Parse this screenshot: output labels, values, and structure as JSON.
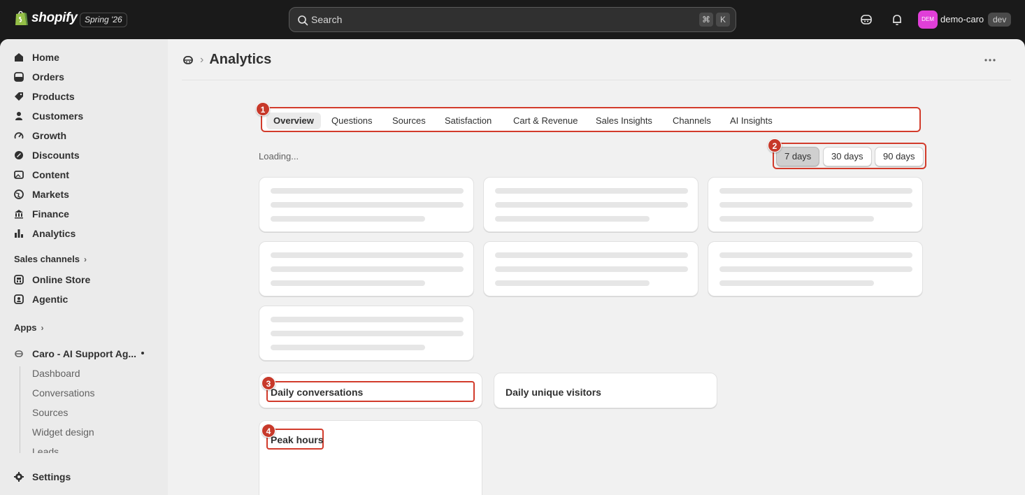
{
  "topbar": {
    "brand": "shopify",
    "version": "Spring '26",
    "search_placeholder": "Search",
    "shortcut_cmd": "⌘",
    "shortcut_key": "K",
    "avatar_initials": "DEM",
    "store_name": "demo-caro",
    "env_badge": "dev"
  },
  "sidebar": {
    "items": [
      {
        "label": "Home",
        "icon": "home-icon"
      },
      {
        "label": "Orders",
        "icon": "inbox-icon"
      },
      {
        "label": "Products",
        "icon": "tag-icon"
      },
      {
        "label": "Customers",
        "icon": "person-icon"
      },
      {
        "label": "Growth",
        "icon": "gauge-icon"
      },
      {
        "label": "Discounts",
        "icon": "discount-icon"
      },
      {
        "label": "Content",
        "icon": "image-icon"
      },
      {
        "label": "Markets",
        "icon": "globe-icon"
      },
      {
        "label": "Finance",
        "icon": "bank-icon"
      },
      {
        "label": "Analytics",
        "icon": "bar-chart-icon"
      }
    ],
    "sales_channels_label": "Sales channels",
    "channels": [
      {
        "label": "Online Store",
        "icon": "store-icon"
      },
      {
        "label": "Agentic",
        "icon": "agent-icon"
      }
    ],
    "apps_label": "Apps",
    "app_name": "Caro - AI Support Ag...",
    "app_subitems": [
      "Dashboard",
      "Conversations",
      "Sources",
      "Widget design",
      "Leads"
    ],
    "settings_label": "Settings"
  },
  "main": {
    "title": "Analytics",
    "tabs": [
      "Overview",
      "Questions",
      "Sources",
      "Satisfaction",
      "Cart & Revenue",
      "Sales Insights",
      "Channels",
      "AI Insights"
    ],
    "active_tab": "Overview",
    "loading_text": "Loading...",
    "ranges": [
      "7 days",
      "30 days",
      "90 days"
    ],
    "selected_range": "7 days",
    "cards": {
      "daily_conversations": "Daily conversations",
      "daily_unique_visitors": "Daily unique visitors",
      "peak_hours": "Peak hours"
    },
    "markers": [
      "1",
      "2",
      "3",
      "4"
    ]
  },
  "colors": {
    "topbar_bg": "#1a1a1a",
    "highlight": "#d23b2b",
    "avatar": "#e03fd8"
  }
}
